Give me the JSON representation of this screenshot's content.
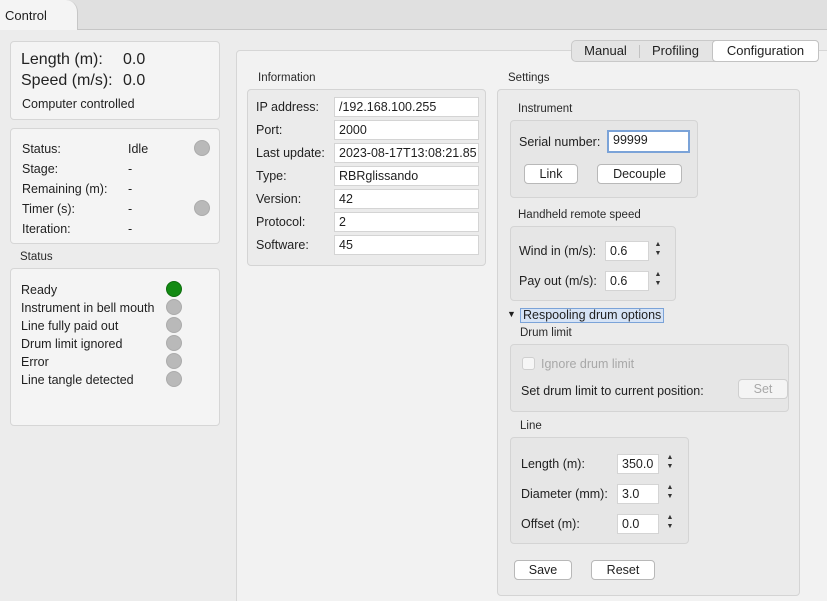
{
  "tabs": {
    "control": "Control"
  },
  "summary": {
    "length_label": "Length (m):",
    "length_value": "0.0",
    "speed_label": "Speed (m/s):",
    "speed_value": "0.0",
    "mode": "Computer controlled"
  },
  "state": {
    "status_label": "Status:",
    "status_value": "Idle",
    "stage_label": "Stage:",
    "stage_value": "-",
    "remaining_label": "Remaining (m):",
    "remaining_value": "-",
    "timer_label": "Timer (s):",
    "timer_value": "-",
    "iteration_label": "Iteration:",
    "iteration_value": "-"
  },
  "status_panel": {
    "title": "Status",
    "items": [
      {
        "label": "Ready",
        "active": true
      },
      {
        "label": "Instrument in bell mouth",
        "active": false
      },
      {
        "label": "Line fully paid out",
        "active": false
      },
      {
        "label": "Drum limit ignored",
        "active": false
      },
      {
        "label": "Error",
        "active": false
      },
      {
        "label": "Line tangle detected",
        "active": false
      }
    ]
  },
  "mode_tabs": {
    "manual": "Manual",
    "profiling": "Profiling",
    "configuration": "Configuration",
    "active": "configuration"
  },
  "information": {
    "title": "Information",
    "rows": [
      {
        "label": "IP address:",
        "value": "/192.168.100.255"
      },
      {
        "label": "Port:",
        "value": "2000"
      },
      {
        "label": "Last update:",
        "value": "2023-08-17T13:08:21.85"
      },
      {
        "label": "Type:",
        "value": "RBRglissando"
      },
      {
        "label": "Version:",
        "value": "42"
      },
      {
        "label": "Protocol:",
        "value": "2"
      },
      {
        "label": "Software:",
        "value": "45"
      }
    ]
  },
  "settings": {
    "title": "Settings",
    "instrument": {
      "title": "Instrument",
      "serial_label": "Serial number:",
      "serial_value": "99999",
      "link_label": "Link",
      "decouple_label": "Decouple"
    },
    "remote": {
      "title": "Handheld remote speed",
      "wind_in_label": "Wind in (m/s):",
      "wind_in_value": "0.6",
      "pay_out_label": "Pay out (m/s):",
      "pay_out_value": "0.6"
    },
    "respooling": {
      "label": "Respooling drum options",
      "drum_limit_title": "Drum limit",
      "ignore_label": "Ignore drum limit",
      "set_limit_label": "Set drum limit to current position:",
      "set_button": "Set"
    },
    "line": {
      "title": "Line",
      "length_label": "Length (m):",
      "length_value": "350.0",
      "diameter_label": "Diameter (mm):",
      "diameter_value": "3.0",
      "offset_label": "Offset (m):",
      "offset_value": "0.0"
    },
    "save_label": "Save",
    "reset_label": "Reset"
  },
  "colors": {
    "led_on": "#128a12",
    "led_off": "#b9b9b9",
    "focus": "#7ba3d8"
  }
}
